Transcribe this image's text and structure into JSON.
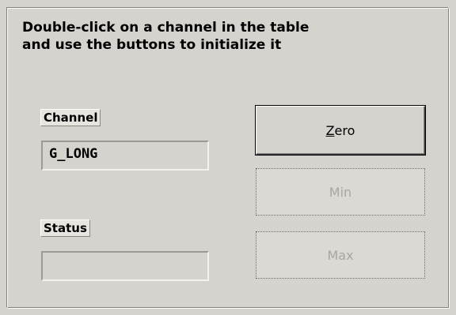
{
  "instructions": {
    "line1": "Double-click on a channel in the table",
    "line2": "and use the buttons to initialize it"
  },
  "channel": {
    "label": "Channel",
    "value": "G_LONG"
  },
  "status": {
    "label": "Status",
    "value": ""
  },
  "buttons": {
    "zero": {
      "mnemonic": "Z",
      "rest": "ero",
      "enabled": true
    },
    "min": {
      "label": "Min",
      "enabled": false
    },
    "max": {
      "label": "Max",
      "enabled": false
    }
  }
}
